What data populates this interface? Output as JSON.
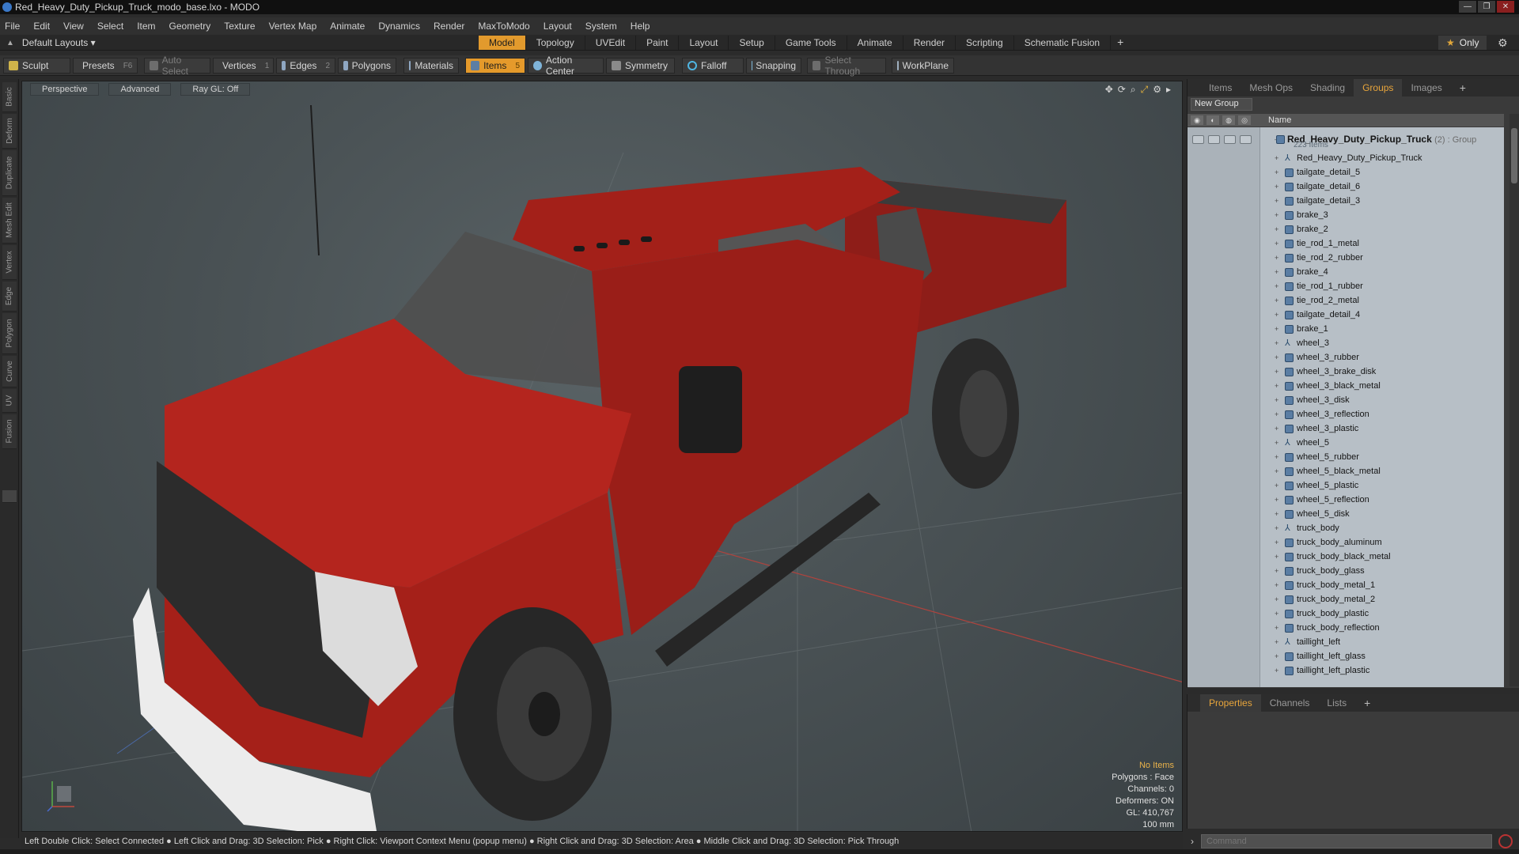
{
  "window": {
    "title": "Red_Heavy_Duty_Pickup_Truck_modo_base.lxo - MODO",
    "controls": [
      "—",
      "❐",
      "✕"
    ]
  },
  "menu": [
    "File",
    "Edit",
    "View",
    "Select",
    "Item",
    "Geometry",
    "Texture",
    "Vertex Map",
    "Animate",
    "Dynamics",
    "Render",
    "MaxToModo",
    "Layout",
    "System",
    "Help"
  ],
  "layouts": {
    "label": "Default Layouts ▾",
    "tabs": [
      "Model",
      "Topology",
      "UVEdit",
      "Paint",
      "Layout",
      "Setup",
      "Game Tools",
      "Animate",
      "Render",
      "Scripting",
      "Schematic Fusion"
    ],
    "plus": "+",
    "active_tab": "Model",
    "only_label": "Only"
  },
  "toolbar": {
    "sculpt": "Sculpt",
    "presets": "Presets",
    "presets_key": "F6",
    "auto_select": "Auto Select",
    "vertices": "Vertices",
    "vertices_count": "1",
    "edges": "Edges",
    "edges_count": "2",
    "polygons": "Polygons",
    "materials": "Materials",
    "items": "Items",
    "items_count": "5",
    "action_center": "Action Center",
    "symmetry": "Symmetry",
    "falloff": "Falloff",
    "snapping": "Snapping",
    "select_through": "Select Through",
    "workplane": "WorkPlane"
  },
  "left_tabs": [
    "Basic",
    "Deform",
    "Duplicate",
    "Mesh Edit",
    "Vertex",
    "Edge",
    "Polygon",
    "Curve",
    "UV",
    "Fusion"
  ],
  "viewport": {
    "view": "Perspective",
    "shading": "Advanced",
    "raygl": "Ray GL: Off",
    "info": {
      "no_items": "No Items",
      "polygons": "Polygons : Face",
      "channels": "Channels: 0",
      "deformers": "Deformers: ON",
      "gl": "GL: 410,767",
      "scale": "100 mm"
    }
  },
  "items_panel": {
    "tabs": [
      "Items",
      "Mesh Ops",
      "Shading",
      "Groups",
      "Images"
    ],
    "active_tab": "Groups",
    "new_group": "New Group",
    "column_name": "Name",
    "group": {
      "name": "Red_Heavy_Duty_Pickup_Truck",
      "meta": "(2) : Group",
      "count": "223 Items"
    },
    "items": [
      {
        "label": "Red_Heavy_Duty_Pickup_Truck",
        "kind": "locator"
      },
      {
        "label": "tailgate_detail_5",
        "kind": "mesh"
      },
      {
        "label": "tailgate_detail_6",
        "kind": "mesh"
      },
      {
        "label": "tailgate_detail_3",
        "kind": "mesh"
      },
      {
        "label": "brake_3",
        "kind": "mesh"
      },
      {
        "label": "brake_2",
        "kind": "mesh"
      },
      {
        "label": "tie_rod_1_metal",
        "kind": "mesh"
      },
      {
        "label": "tie_rod_2_rubber",
        "kind": "mesh"
      },
      {
        "label": "brake_4",
        "kind": "mesh"
      },
      {
        "label": "tie_rod_1_rubber",
        "kind": "mesh"
      },
      {
        "label": "tie_rod_2_metal",
        "kind": "mesh"
      },
      {
        "label": "tailgate_detail_4",
        "kind": "mesh"
      },
      {
        "label": "brake_1",
        "kind": "mesh"
      },
      {
        "label": "wheel_3",
        "kind": "locator"
      },
      {
        "label": "wheel_3_rubber",
        "kind": "mesh"
      },
      {
        "label": "wheel_3_brake_disk",
        "kind": "mesh"
      },
      {
        "label": "wheel_3_black_metal",
        "kind": "mesh"
      },
      {
        "label": "wheel_3_disk",
        "kind": "mesh"
      },
      {
        "label": "wheel_3_reflection",
        "kind": "mesh"
      },
      {
        "label": "wheel_3_plastic",
        "kind": "mesh"
      },
      {
        "label": "wheel_5",
        "kind": "locator"
      },
      {
        "label": "wheel_5_rubber",
        "kind": "mesh"
      },
      {
        "label": "wheel_5_black_metal",
        "kind": "mesh"
      },
      {
        "label": "wheel_5_plastic",
        "kind": "mesh"
      },
      {
        "label": "wheel_5_reflection",
        "kind": "mesh"
      },
      {
        "label": "wheel_5_disk",
        "kind": "mesh"
      },
      {
        "label": "truck_body",
        "kind": "locator"
      },
      {
        "label": "truck_body_aluminum",
        "kind": "mesh"
      },
      {
        "label": "truck_body_black_metal",
        "kind": "mesh"
      },
      {
        "label": "truck_body_glass",
        "kind": "mesh"
      },
      {
        "label": "truck_body_metal_1",
        "kind": "mesh"
      },
      {
        "label": "truck_body_metal_2",
        "kind": "mesh"
      },
      {
        "label": "truck_body_plastic",
        "kind": "mesh"
      },
      {
        "label": "truck_body_reflection",
        "kind": "mesh"
      },
      {
        "label": "taillight_left",
        "kind": "locator"
      },
      {
        "label": "taillight_left_glass",
        "kind": "mesh"
      },
      {
        "label": "taillight_left_plastic",
        "kind": "mesh"
      }
    ]
  },
  "props_panel": {
    "tabs": [
      "Properties",
      "Channels",
      "Lists"
    ],
    "active_tab": "Properties",
    "plus": "+"
  },
  "command": {
    "placeholder": "Command"
  },
  "status": {
    "text": "Left Double Click: Select Connected ● Left Click and Drag: 3D Selection: Pick ● Right Click: Viewport Context Menu (popup menu) ● Right Click and Drag: 3D Selection: Area ● Middle Click and Drag: 3D Selection: Pick Through"
  },
  "colors": {
    "accent": "#e29a2d",
    "truck_red": "#a8211c",
    "tree_bg": "#b7bfc6"
  }
}
